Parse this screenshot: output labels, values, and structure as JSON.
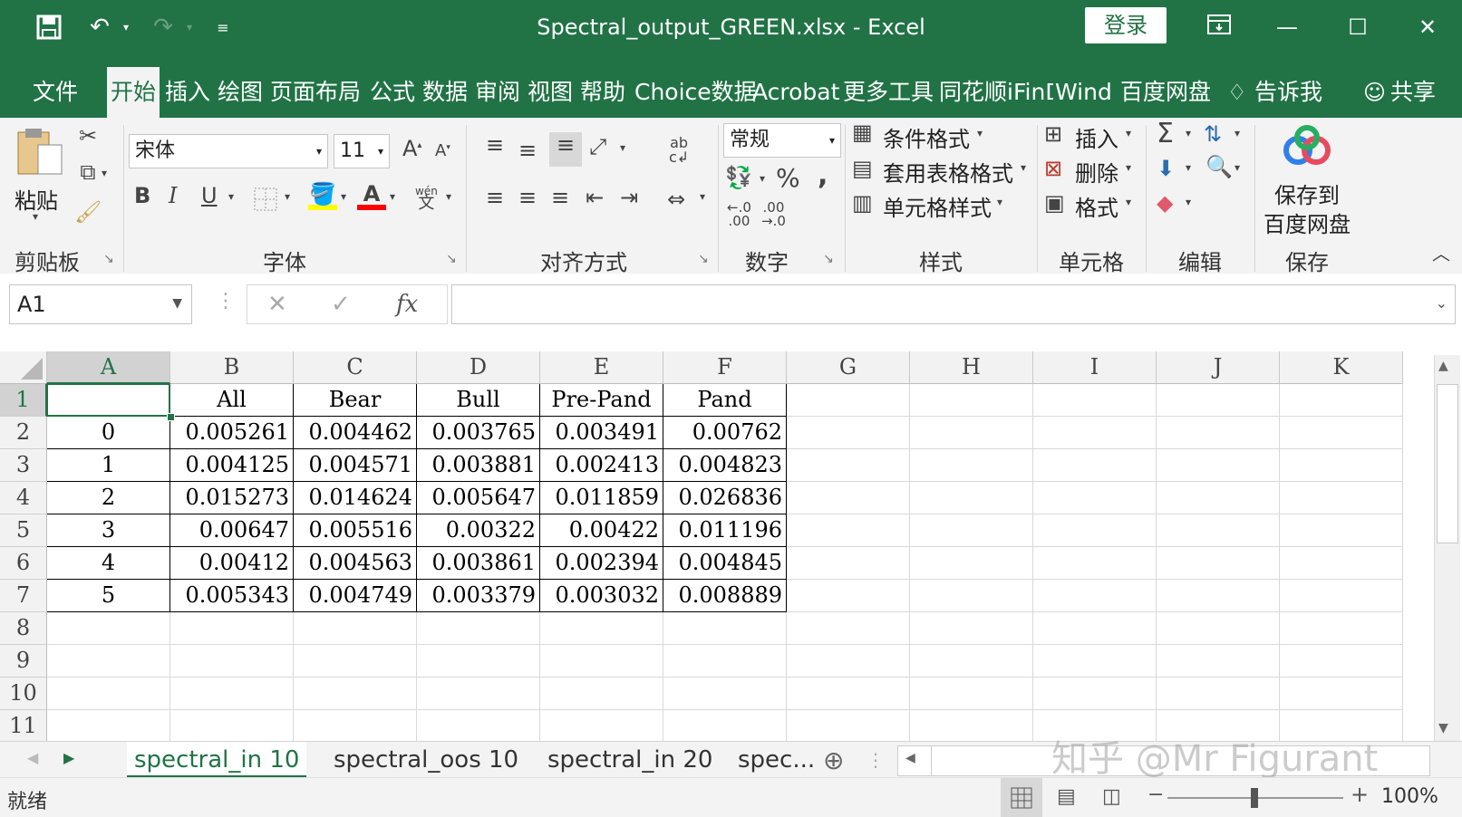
{
  "titlebar": {
    "title": "Spectral_output_GREEN.xlsx  -  Excel",
    "login": "登录"
  },
  "tabs": [
    "文件",
    "开始",
    "插入",
    "绘图",
    "页面布局",
    "公式",
    "数据",
    "审阅",
    "视图",
    "帮助",
    "Choice数据",
    "Acrobat",
    "更多工具",
    "同花顺iFinD",
    "Wind",
    "百度网盘",
    "告诉我",
    "共享"
  ],
  "active_tab": "开始",
  "ribbon": {
    "clipboard": {
      "paste": "粘贴",
      "label": "剪贴板"
    },
    "font": {
      "name": "宋体",
      "size": "11",
      "label": "字体",
      "bold": "B",
      "italic": "I",
      "underline": "U",
      "font_color": "A",
      "inc": "A",
      "dec": "A",
      "phonetic_top": "wén",
      "phonetic_bottom": "文"
    },
    "alignment": {
      "label": "对齐方式",
      "wrap_top": "ab",
      "wrap_bottom": "c"
    },
    "number": {
      "format": "常规",
      "label": "数字",
      "percent": "%",
      "comma": ",",
      "inc_dec": ".00",
      "dec_dec": ".0"
    },
    "styles": {
      "cond": "条件格式",
      "table": "套用表格格式",
      "cell": "单元格样式",
      "label": "样式"
    },
    "cells": {
      "insert": "插入",
      "delete": "删除",
      "format": "格式",
      "label": "单元格"
    },
    "editing": {
      "label": "编辑",
      "sigma": "Σ"
    },
    "save": {
      "line1": "保存到",
      "line2": "百度网盘",
      "label": "保存"
    }
  },
  "formula_bar": {
    "name_box": "A1",
    "fx": "fx",
    "value": ""
  },
  "columns": [
    "A",
    "B",
    "C",
    "D",
    "E",
    "F",
    "G",
    "H",
    "I",
    "J",
    "K"
  ],
  "rows": [
    "1",
    "2",
    "3",
    "4",
    "5",
    "6",
    "7",
    "8",
    "9",
    "10",
    "11"
  ],
  "table": {
    "header": [
      "",
      "All",
      "Bear",
      "Bull",
      "Pre-Pand",
      "Pand"
    ],
    "data": [
      [
        "0",
        "0.005261",
        "0.004462",
        "0.003765",
        "0.003491",
        "0.00762"
      ],
      [
        "1",
        "0.004125",
        "0.004571",
        "0.003881",
        "0.002413",
        "0.004823"
      ],
      [
        "2",
        "0.015273",
        "0.014624",
        "0.005647",
        "0.011859",
        "0.026836"
      ],
      [
        "3",
        "0.00647",
        "0.005516",
        "0.00322",
        "0.00422",
        "0.011196"
      ],
      [
        "4",
        "0.00412",
        "0.004563",
        "0.003861",
        "0.002394",
        "0.004845"
      ],
      [
        "5",
        "0.005343",
        "0.004749",
        "0.003379",
        "0.003032",
        "0.008889"
      ]
    ]
  },
  "sheets": [
    "spectral_in 10",
    "spectral_oos 10",
    "spectral_in 20",
    "spec..."
  ],
  "status": {
    "ready": "就绪",
    "zoom": "100%"
  },
  "watermark": "知乎 @Mr Figurant",
  "colors": {
    "excel_green": "#217346"
  }
}
